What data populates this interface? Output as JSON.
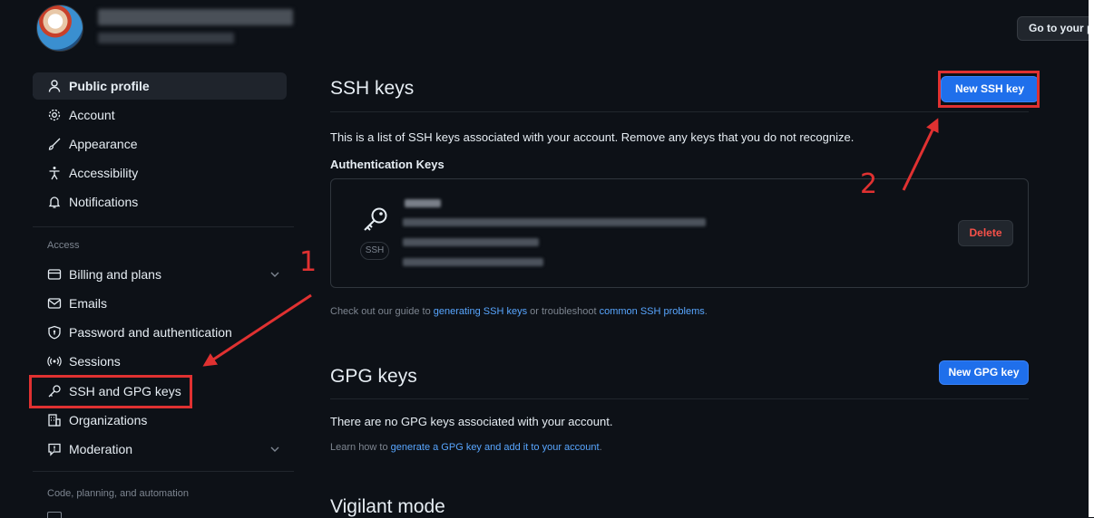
{
  "header": {
    "go_to_profile_label": "Go to your p"
  },
  "sidebar": {
    "items_top": [
      {
        "label": "Public profile",
        "icon": "person-icon",
        "active": true
      },
      {
        "label": "Account",
        "icon": "gear-icon"
      },
      {
        "label": "Appearance",
        "icon": "paintbrush-icon"
      },
      {
        "label": "Accessibility",
        "icon": "accessibility-icon"
      },
      {
        "label": "Notifications",
        "icon": "bell-icon"
      }
    ],
    "access_heading": "Access",
    "items_access": [
      {
        "label": "Billing and plans",
        "icon": "credit-card-icon",
        "has_chevron": true
      },
      {
        "label": "Emails",
        "icon": "mail-icon"
      },
      {
        "label": "Password and authentication",
        "icon": "shield-lock-icon"
      },
      {
        "label": "Sessions",
        "icon": "broadcast-icon"
      },
      {
        "label": "SSH and GPG keys",
        "icon": "key-icon"
      },
      {
        "label": "Organizations",
        "icon": "organization-icon"
      },
      {
        "label": "Moderation",
        "icon": "report-icon",
        "has_chevron": true
      }
    ],
    "code_heading": "Code, planning, and automation"
  },
  "ssh": {
    "title": "SSH keys",
    "new_button": "New SSH key",
    "description": "This is a list of SSH keys associated with your account. Remove any keys that you do not recognize.",
    "auth_heading": "Authentication Keys",
    "key_badge": "SSH",
    "delete_button": "Delete",
    "guide_prefix": "Check out our guide to ",
    "guide_link1": "generating SSH keys",
    "guide_middle": " or troubleshoot ",
    "guide_link2": "common SSH problems",
    "guide_suffix": "."
  },
  "gpg": {
    "title": "GPG keys",
    "new_button": "New GPG key",
    "empty_text": "There are no GPG keys associated with your account.",
    "learn_prefix": "Learn how to ",
    "learn_link": "generate a GPG key and add it to your account",
    "learn_suffix": "."
  },
  "vigilant": {
    "title": "Vigilant mode"
  },
  "annotations": {
    "step1": "1",
    "step2": "2",
    "color": "#e03131"
  },
  "colors": {
    "background": "#0d1117",
    "accent": "#1f6feb",
    "link": "#58a6ff",
    "danger": "#f85149"
  }
}
